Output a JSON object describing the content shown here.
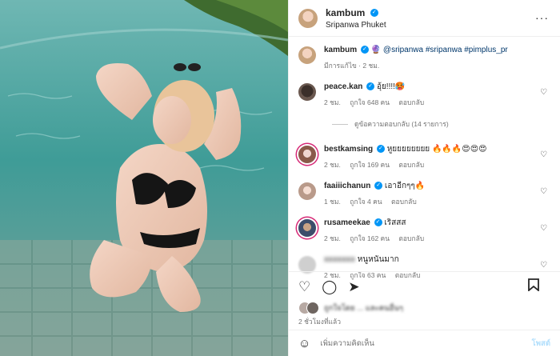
{
  "header": {
    "username": "kambum",
    "location": "Sripanwa Phuket",
    "more_icon": "more-horizontal-icon"
  },
  "caption": {
    "username": "kambum",
    "emoji": "🔮",
    "mention": "@sripanwa",
    "hashtags": "#sripanwa #pimplus_pr",
    "meta": "มีการแก้ไข · 2 ชม."
  },
  "comments": [
    {
      "username": "peace.kan",
      "text": "อุ้ย!!!!🥵",
      "time": "2 ชม.",
      "likes": "ถูกใจ 648 คน",
      "reply": "ตอบกลับ"
    },
    {
      "username": "bestkamsing",
      "text": "หูยยยยยยยย 🔥🔥🔥😍😍😍",
      "time": "2 ชม.",
      "likes": "ถูกใจ 169 คน",
      "reply": "ตอบกลับ"
    },
    {
      "username": "faaiiichanun",
      "text": "เอาอีกๆๆ🔥",
      "time": "1 ชม.",
      "likes": "ถูกใจ 4 คน",
      "reply": "ตอบกลับ"
    },
    {
      "username": "rusameekae",
      "text": "เริสสส",
      "time": "2 ชม.",
      "likes": "ถูกใจ 162 คน",
      "reply": "ตอบกลับ"
    },
    {
      "username": "",
      "text": "หนูหนันมาก",
      "time": "2 ชม.",
      "likes": "ถูกใจ 63 คน",
      "reply": "ตอบกลับ"
    }
  ],
  "view_replies": "ดูข้อความตอบกลับ (14 รายการ)",
  "likes_text": "ถูกใจโดย ... และคนอื่นๆ",
  "posted_time": "2 ชั่วโมงที่แล้ว",
  "add_comment": {
    "placeholder": "เพิ่มความคิดเห็น",
    "post_label": "โพสต์"
  },
  "icons": [
    "heart-icon",
    "comment-icon",
    "share-icon",
    "bookmark-icon",
    "emoji-icon"
  ],
  "colors": {
    "verified": "#0095f6",
    "link": "#00376b",
    "muted": "#737373"
  }
}
